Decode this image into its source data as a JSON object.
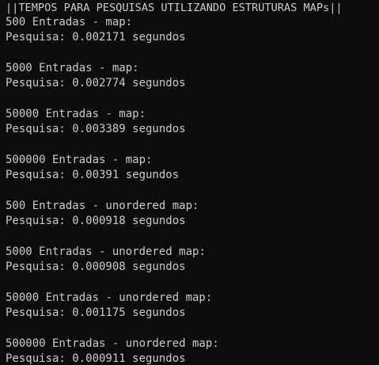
{
  "terminal": {
    "header": "||TEMPOS PARA PESQUISAS UTILIZANDO ESTRUTURAS MAPs||",
    "results": [
      {
        "title": "500 Entradas - map:",
        "time": "Pesquisa: 0.002171 segundos"
      },
      {
        "title": "5000 Entradas - map:",
        "time": "Pesquisa: 0.002774 segundos"
      },
      {
        "title": "50000 Entradas - map:",
        "time": "Pesquisa: 0.003389 segundos"
      },
      {
        "title": "500000 Entradas - map:",
        "time": "Pesquisa: 0.00391 segundos"
      },
      {
        "title": "500 Entradas - unordered map:",
        "time": "Pesquisa: 0.000918 segundos"
      },
      {
        "title": "5000 Entradas - unordered map:",
        "time": "Pesquisa: 0.000908 segundos"
      },
      {
        "title": "50000 Entradas - unordered map:",
        "time": "Pesquisa: 0.001175 segundos"
      },
      {
        "title": "500000 Entradas - unordered map:",
        "time": "Pesquisa: 0.000911 segundos"
      }
    ]
  },
  "colors": {
    "background": "#0c0c0c",
    "text": "#cccccc"
  }
}
